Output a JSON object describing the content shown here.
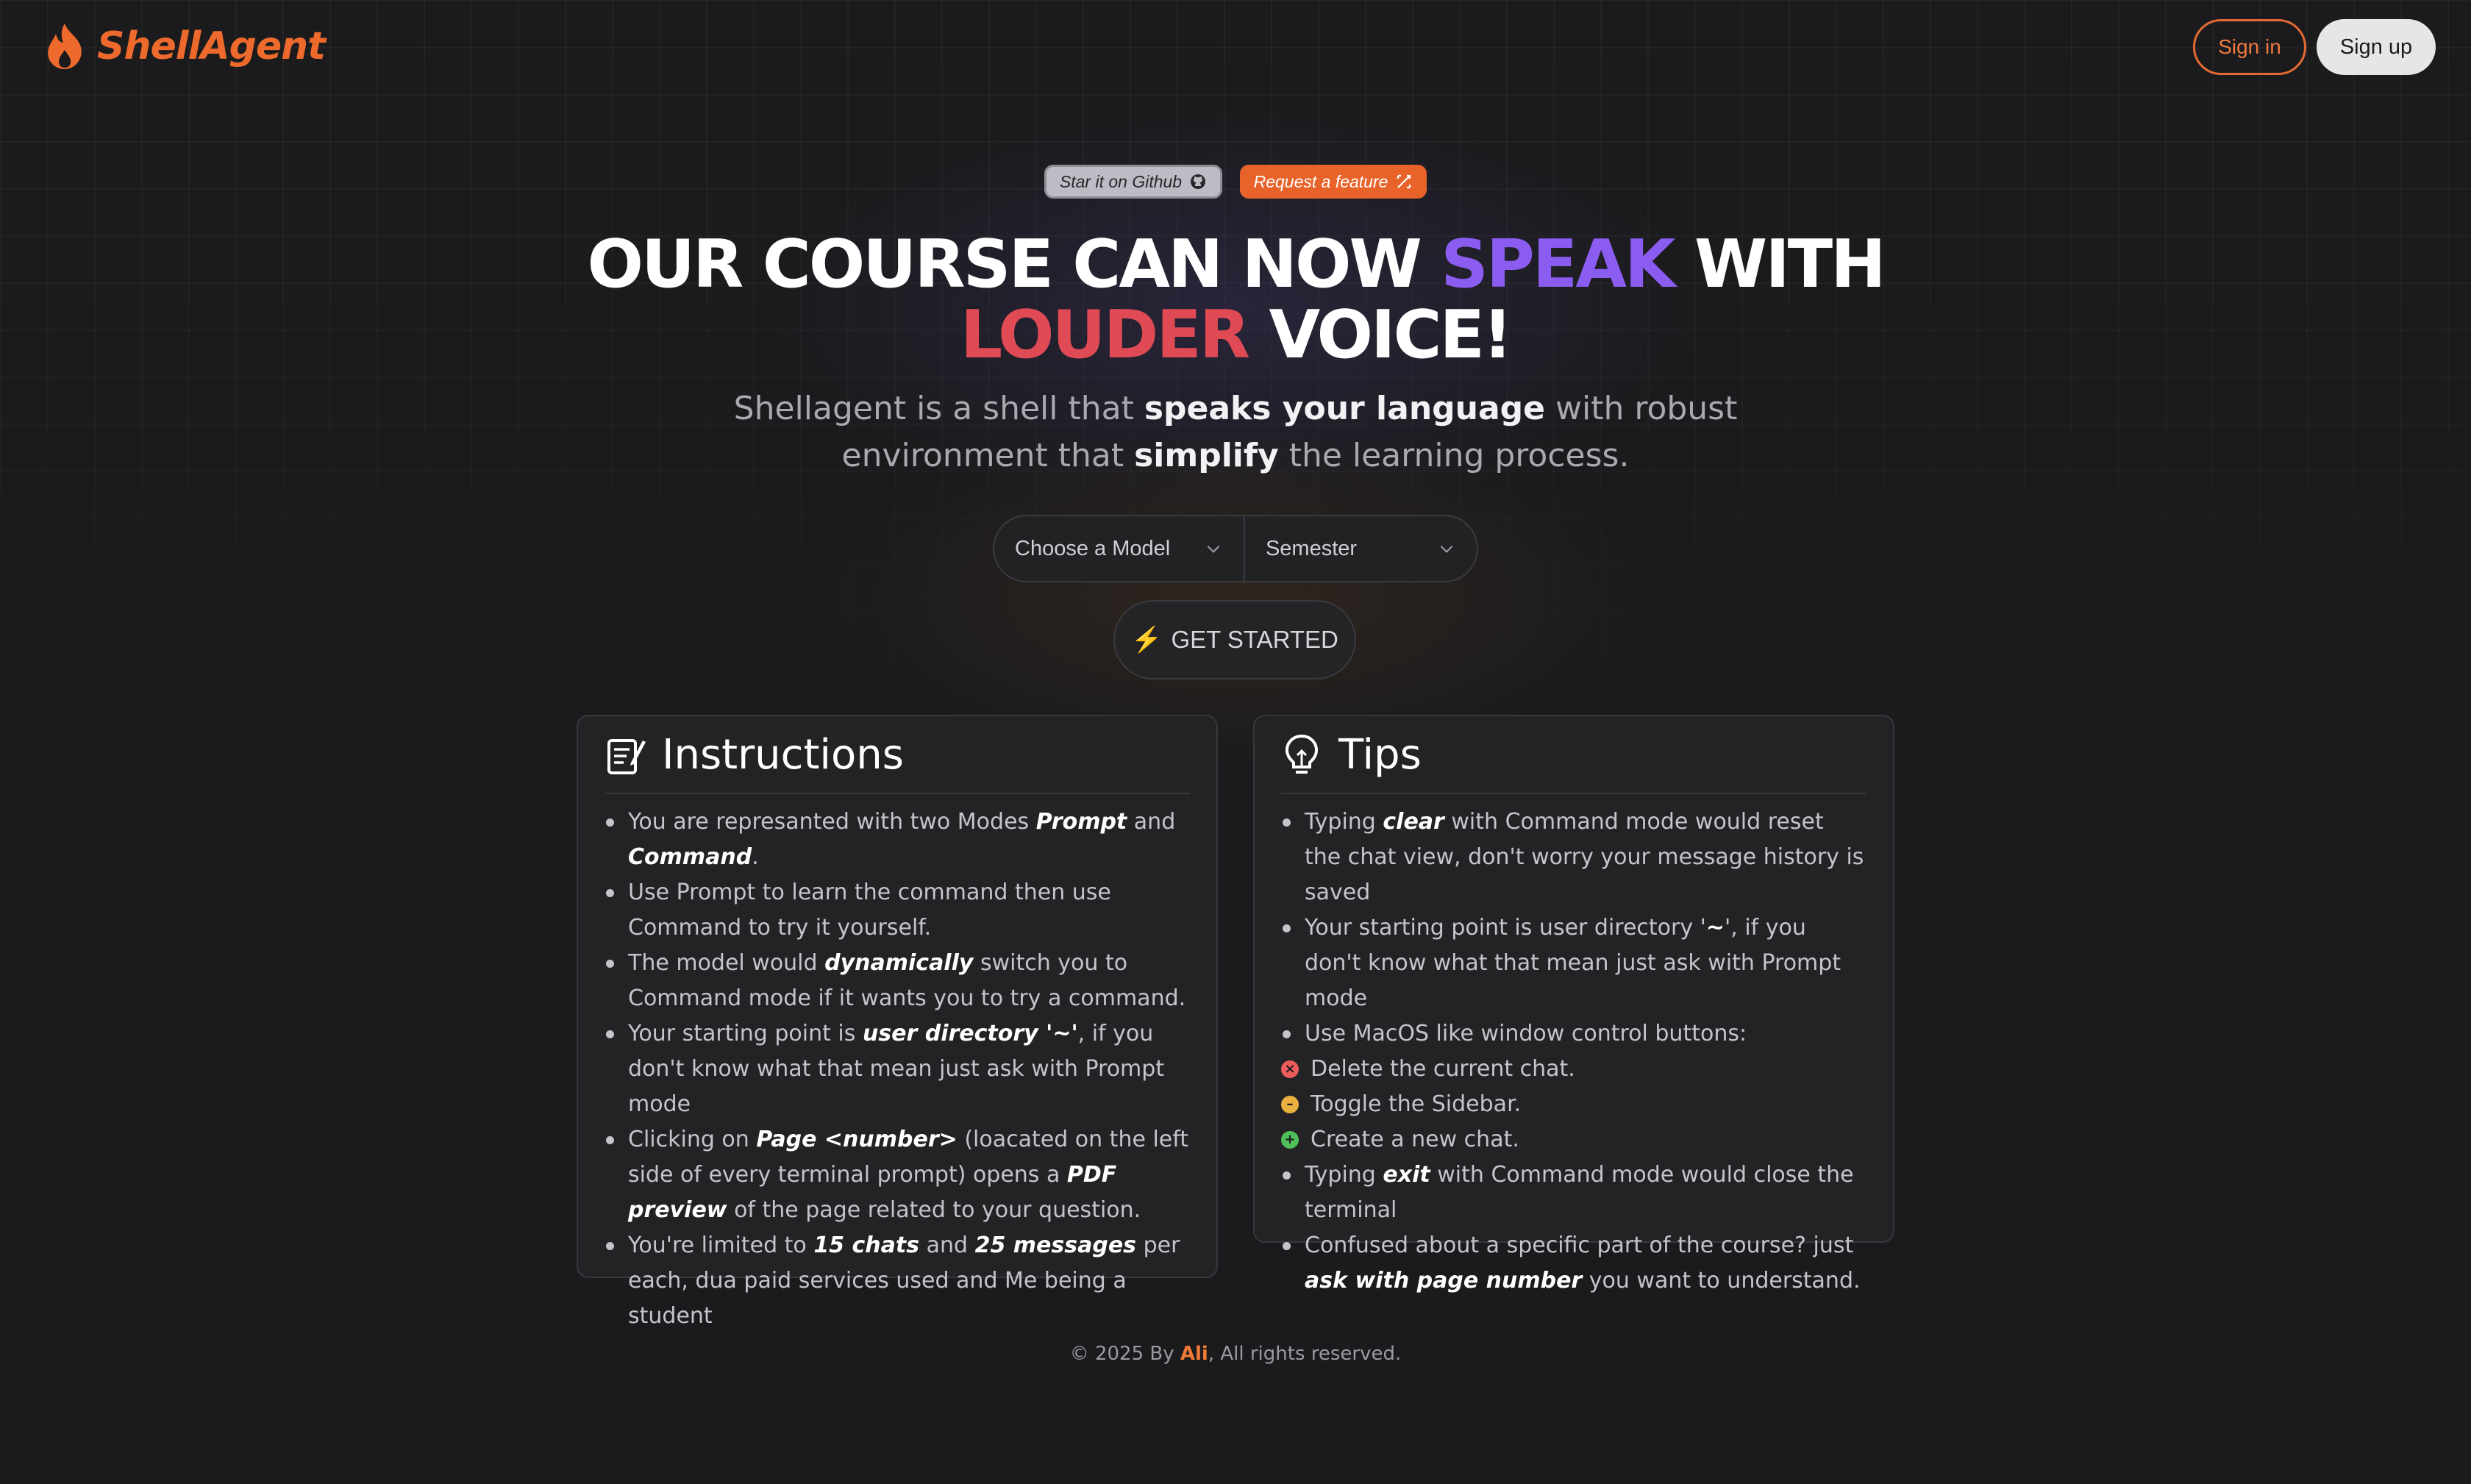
{
  "header": {
    "brand": "ShellAgent",
    "sign_in_label": "Sign in",
    "sign_up_label": "Sign up"
  },
  "pills": {
    "github_label": "Star it on Github",
    "feature_label": "Request a feature"
  },
  "hero": {
    "line1_a": "OUR COURSE CAN NOW ",
    "line1_b": "SPEAK",
    "line1_c": " WITH",
    "line2_a": "LOUDER",
    "line2_b": " VOICE!",
    "sub_1": "Shellagent is a shell that ",
    "sub_2": "speaks your language",
    "sub_3": " with robust",
    "sub_4": "environment that ",
    "sub_5": "simplify",
    "sub_6": " the learning process."
  },
  "controls": {
    "model_select": "Choose a Model",
    "semester_select": "Semester",
    "start_label": "GET STARTED"
  },
  "instructions": {
    "title": "Instructions",
    "items": [
      {
        "a": "You are represanted with two Modes ",
        "b": "Prompt",
        "c": " and ",
        "d": "Command",
        "e": "."
      },
      {
        "a": "Use Prompt to learn the command then use Command to try it yourself."
      },
      {
        "a": "The model would ",
        "b": "dynamically",
        "c": " switch you to Command mode if it wants you to try a command."
      },
      {
        "a": "Your starting point is ",
        "b": "user directory '~'",
        "c": ", if you don't know what that mean just ask with Prompt mode"
      },
      {
        "a": "Clicking on ",
        "b": "Page <number>",
        "c": " (loacated on the left side of every terminal prompt) opens a ",
        "d": "PDF preview",
        "e": " of the page related to your question."
      },
      {
        "a": "You're limited to ",
        "b": "15 chats",
        "c": " and ",
        "d": "25 messages",
        "e": " per each, dua paid services used and Me being a student"
      }
    ]
  },
  "tips": {
    "title": "Tips",
    "items": [
      {
        "a": "Typing ",
        "b": "clear",
        "c": " with Command mode would reset the chat view, don't worry your message history is saved"
      },
      {
        "a": "Your starting point is user directory '",
        "b": "~",
        "c": "', if you don't know what that mean just ask with Prompt mode"
      },
      {
        "a": "Use MacOS like window control buttons:"
      },
      {
        "a": "Typing ",
        "b": "exit",
        "c": " with Command mode would close the terminal"
      },
      {
        "a": "Confused about a specific part of the course? just ",
        "b": "ask with page number",
        "c": " you want to understand."
      }
    ],
    "controls": [
      {
        "label": "Delete the current chat.",
        "color": "#ec5c5c",
        "glyph": "×"
      },
      {
        "label": "Toggle the Sidebar.",
        "color": "#eab040",
        "glyph": "–"
      },
      {
        "label": "Create a new chat.",
        "color": "#4fbf5a",
        "glyph": "+"
      }
    ]
  },
  "footer": {
    "prefix": "© 2025 By ",
    "author": "Ali",
    "suffix": ", All rights reserved."
  },
  "colors": {
    "accent": "#ee6a2c",
    "purple": "#8a5cf0",
    "red": "#e04a55"
  }
}
